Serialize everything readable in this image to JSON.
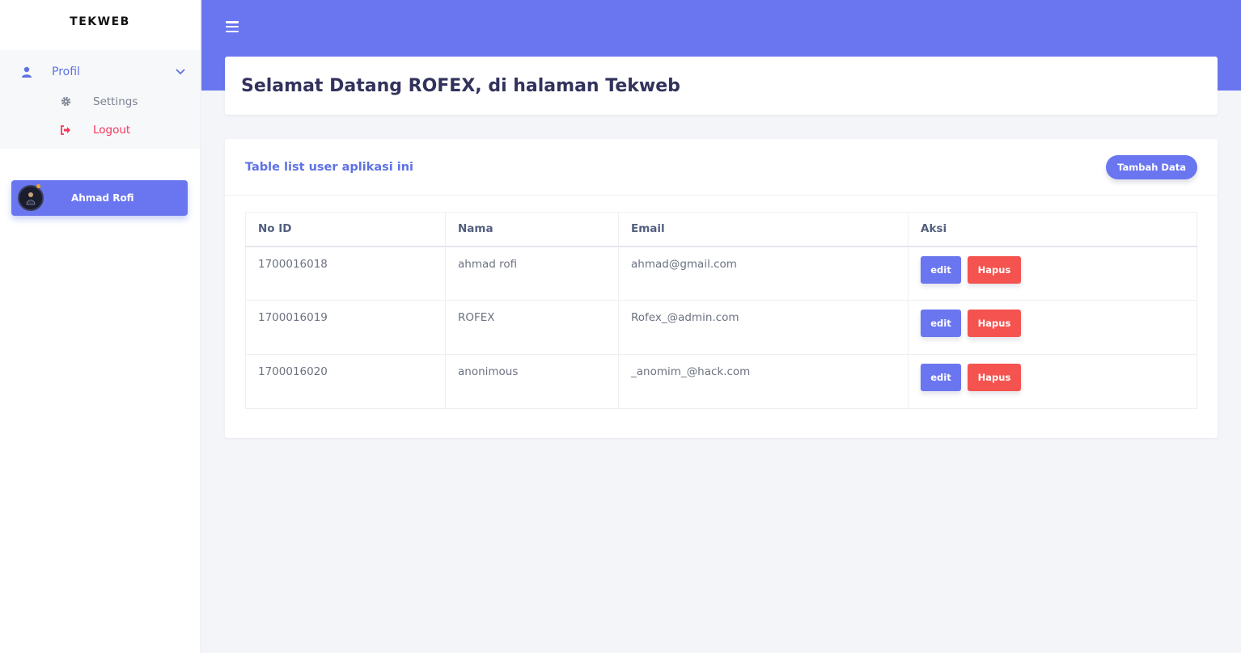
{
  "brand": "TEKWEB",
  "sidebar": {
    "profil_label": "Profil",
    "settings_label": "Settings",
    "logout_label": "Logout",
    "user_name": "Ahmad Rofi"
  },
  "header": {
    "welcome": "Selamat Datang ROFEX, di halaman Tekweb"
  },
  "table_card": {
    "title": "Table list user aplikasi ini",
    "add_button": "Tambah Data",
    "columns": [
      "No ID",
      "Nama",
      "Email",
      "Aksi"
    ],
    "rows": [
      {
        "id": "1700016018",
        "nama": "ahmad rofi",
        "email": "ahmad@gmail.com",
        "edit": "edit",
        "hapus": "Hapus"
      },
      {
        "id": "1700016019",
        "nama": "ROFEX",
        "email": "Rofex_@admin.com",
        "edit": "edit",
        "hapus": "Hapus"
      },
      {
        "id": "1700016020",
        "nama": "anonimous",
        "email": "_anomim_@hack.com",
        "edit": "edit",
        "hapus": "Hapus"
      }
    ]
  },
  "colors": {
    "primary": "#6a76ef",
    "danger": "#f5534f",
    "logout": "#f5365c"
  },
  "icons": {
    "menu": "hamburger-icon",
    "profil": "user-icon",
    "chevron": "chevron-down-icon",
    "settings": "gear-icon",
    "logout": "sign-out-icon"
  }
}
